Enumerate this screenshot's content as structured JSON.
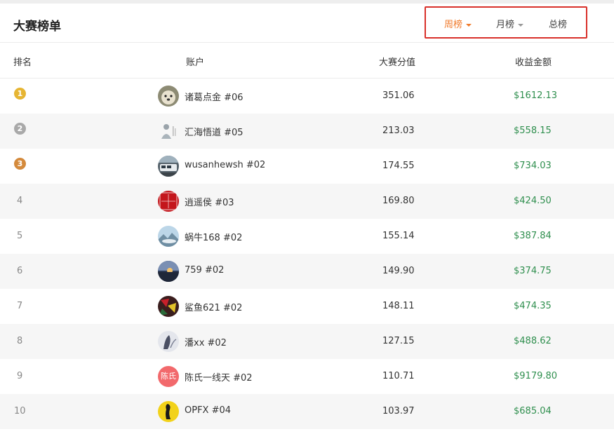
{
  "header": {
    "title": "大赛榜单",
    "tabs": [
      {
        "label": "周榜",
        "active": true
      },
      {
        "label": "月榜",
        "active": false
      },
      {
        "label": "总榜",
        "active": false
      }
    ]
  },
  "table": {
    "columns": [
      "排名",
      "账户",
      "大赛分值",
      "收益金额"
    ],
    "rows": [
      {
        "rank": "1",
        "medal": "gold",
        "name": "诸葛点金 #06",
        "score": "351.06",
        "profit": "$1612.13",
        "avatar": "dog-photo"
      },
      {
        "rank": "2",
        "medal": "silver",
        "name": "汇海悟道 #05",
        "score": "213.03",
        "profit": "$558.15",
        "avatar": "buddha-figure"
      },
      {
        "rank": "3",
        "medal": "bronze",
        "name": "wusanhewsh #02",
        "score": "174.55",
        "profit": "$734.03",
        "avatar": "train-photo"
      },
      {
        "rank": "4",
        "medal": "",
        "name": "逍遥侯 #03",
        "score": "169.80",
        "profit": "$424.50",
        "avatar": "red-seal"
      },
      {
        "rank": "5",
        "medal": "",
        "name": "蜗牛168 #02",
        "score": "155.14",
        "profit": "$387.84",
        "avatar": "sky-landscape"
      },
      {
        "rank": "6",
        "medal": "",
        "name": "759 #02",
        "score": "149.90",
        "profit": "$374.75",
        "avatar": "sunset-landscape"
      },
      {
        "rank": "7",
        "medal": "",
        "name": "鲨鱼621 #02",
        "score": "148.11",
        "profit": "$474.35",
        "avatar": "colorful-photo"
      },
      {
        "rank": "8",
        "medal": "",
        "name": "潘xx #02",
        "score": "127.15",
        "profit": "$488.62",
        "avatar": "ink-painting"
      },
      {
        "rank": "9",
        "medal": "",
        "name": "陈氏一线天 #02",
        "score": "110.71",
        "profit": "$9179.80",
        "avatar": "text-avatar"
      },
      {
        "rank": "10",
        "medal": "",
        "name": "OPFX #04",
        "score": "103.97",
        "profit": "$685.04",
        "avatar": "yellow-silhouette"
      }
    ]
  },
  "avatar_text": {
    "row9": "陈氏",
    "row4": "侯逍印遥"
  },
  "colors": {
    "accent": "#f07a2b",
    "profit": "#2f8f4e",
    "highlight_border": "#d9302a",
    "gold": "#e6b533",
    "silver": "#a9a9a9",
    "bronze": "#d48a3c"
  }
}
